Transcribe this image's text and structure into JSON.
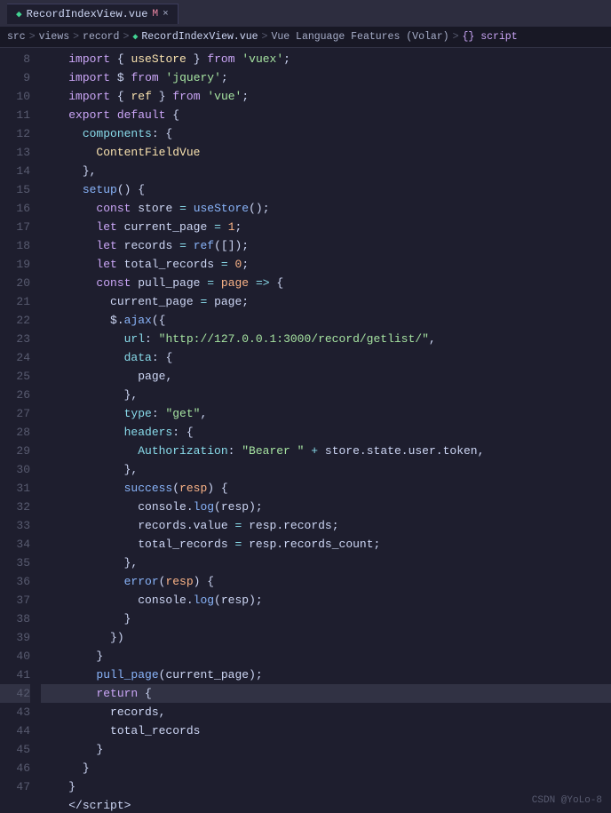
{
  "titleBar": {
    "tab": {
      "vueIcon": "◆",
      "filename": "RecordIndexView.vue",
      "badge": "M",
      "closeIcon": "×"
    }
  },
  "breadcrumb": {
    "items": [
      "src",
      ">",
      "views",
      ">",
      "record",
      ">",
      "RecordIndexView.vue",
      ">",
      "Vue Language Features (Volar)",
      ">",
      "{} script"
    ]
  },
  "lines": {
    "start": 8,
    "end": 47
  },
  "watermark": "CSDN @YoLo-8"
}
